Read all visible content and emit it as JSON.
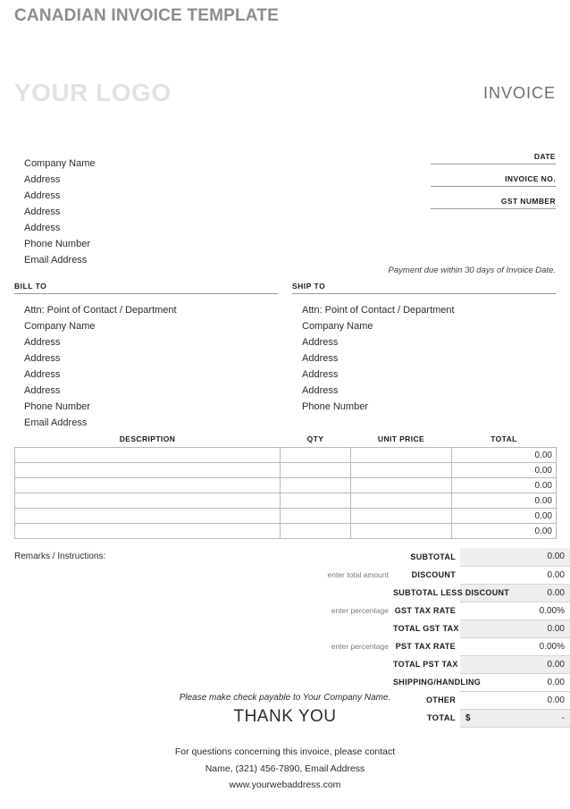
{
  "document": {
    "template_title": "CANADIAN INVOICE TEMPLATE",
    "logo_placeholder": "YOUR LOGO",
    "invoice_word": "INVOICE"
  },
  "company": {
    "lines": [
      "Company Name",
      "Address",
      "Address",
      "Address",
      "Address",
      "Phone Number",
      "Email Address"
    ]
  },
  "meta_fields": [
    {
      "label": "DATE",
      "value": ""
    },
    {
      "label": "INVOICE NO.",
      "value": ""
    },
    {
      "label": "GST NUMBER",
      "value": ""
    }
  ],
  "payment_note": "Payment due within 30 days of Invoice Date.",
  "bill_to": {
    "title": "BILL TO",
    "lines": [
      "Attn: Point of Contact / Department",
      "Company Name",
      "Address",
      "Address",
      "Address",
      "Address",
      "Phone Number",
      "Email Address"
    ]
  },
  "ship_to": {
    "title": "SHIP TO",
    "lines": [
      "Attn: Point of Contact / Department",
      "Company Name",
      "Address",
      "Address",
      "Address",
      "Address",
      "Phone Number"
    ]
  },
  "items_table": {
    "headers": [
      "DESCRIPTION",
      "QTY",
      "UNIT PRICE",
      "TOTAL"
    ],
    "rows": [
      {
        "description": "",
        "qty": "",
        "unit_price": "",
        "total": "0.00"
      },
      {
        "description": "",
        "qty": "",
        "unit_price": "",
        "total": "0.00"
      },
      {
        "description": "",
        "qty": "",
        "unit_price": "",
        "total": "0.00"
      },
      {
        "description": "",
        "qty": "",
        "unit_price": "",
        "total": "0.00"
      },
      {
        "description": "",
        "qty": "",
        "unit_price": "",
        "total": "0.00"
      },
      {
        "description": "",
        "qty": "",
        "unit_price": "",
        "total": "0.00"
      }
    ]
  },
  "remarks_label": "Remarks / Instructions:",
  "totals": [
    {
      "hint": "",
      "label": "SUBTOTAL",
      "value": "0.00",
      "shaded": true
    },
    {
      "hint": "enter total amount",
      "label": "DISCOUNT",
      "value": "0.00",
      "shaded": false
    },
    {
      "hint": "",
      "label": "SUBTOTAL LESS DISCOUNT",
      "value": "0.00",
      "shaded": true
    },
    {
      "hint": "enter percentage",
      "label": "GST TAX RATE",
      "value": "0.00%",
      "shaded": false
    },
    {
      "hint": "",
      "label": "TOTAL GST TAX",
      "value": "0.00",
      "shaded": true
    },
    {
      "hint": "enter percentage",
      "label": "PST TAX RATE",
      "value": "0.00%",
      "shaded": false
    },
    {
      "hint": "",
      "label": "TOTAL PST TAX",
      "value": "0.00",
      "shaded": true
    },
    {
      "hint": "",
      "label": "SHIPPING/HANDLING",
      "value": "0.00",
      "shaded": false
    },
    {
      "hint": "",
      "label": "OTHER",
      "value": "0.00",
      "shaded": false
    },
    {
      "hint": "",
      "label": "TOTAL",
      "value": "-",
      "shaded": true,
      "currency": "$"
    }
  ],
  "footer": {
    "payable_note": "Please make check payable to Your Company Name.",
    "thank_you": "THANK YOU",
    "contact_line_1": "For questions concerning this invoice, please contact",
    "contact_line_2": "Name, (321) 456-7890, Email Address",
    "website": "www.yourwebaddress.com"
  },
  "colors": {
    "title_gray": "#8c8c8c",
    "logo_gray": "#e2e2e2",
    "text": "#231f20",
    "rule": "#9a9a9a",
    "cell_border": "#b9b9b9",
    "shade": "#eeeeee"
  }
}
